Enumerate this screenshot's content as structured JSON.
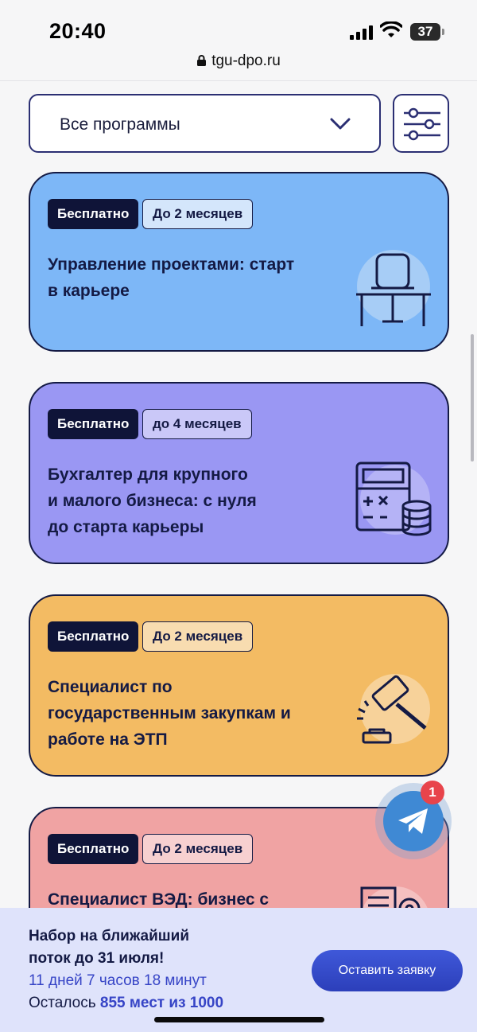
{
  "status_bar": {
    "time": "20:40",
    "battery": "37",
    "url": "tgu-dpo.ru"
  },
  "filters": {
    "program_select": "Все программы"
  },
  "cards": [
    {
      "price": "Бесплатно",
      "duration": "До 2 месяцев",
      "title_lines": [
        "Управление проектами: старт",
        "в карьере"
      ],
      "color": "#7db7f7",
      "icon": "desk-chair-icon"
    },
    {
      "price": "Бесплатно",
      "duration": "до 4 месяцев",
      "title_lines": [
        "Бухгалтер для крупного",
        "и малого бизнеса: с нуля",
        "до старта карьеры"
      ],
      "color": "#9a97f3",
      "icon": "calculator-coins-icon"
    },
    {
      "price": "Бесплатно",
      "duration": "До 2 месяцев",
      "title_lines": [
        "Специалист по",
        "государственным закупкам и",
        "работе на ЭТП"
      ],
      "color": "#f3bb63",
      "icon": "gavel-icon"
    },
    {
      "price": "Бесплатно",
      "duration": "До 2 месяцев",
      "title_lines": [
        "Специалист ВЭД: бизнес с"
      ],
      "color": "#f0a3a3",
      "icon": "documents-gear-icon"
    }
  ],
  "telegram": {
    "badge_count": "1",
    "icon": "telegram-icon"
  },
  "enrollment": {
    "line1": "Набор на ближайший",
    "line2": "поток до 31 июля!",
    "timer": "11 дней 7 часов 18 минут",
    "seats_prefix": "Осталось",
    "seats_value": "855 мест из 1000",
    "apply_label": "Оставить заявку"
  }
}
